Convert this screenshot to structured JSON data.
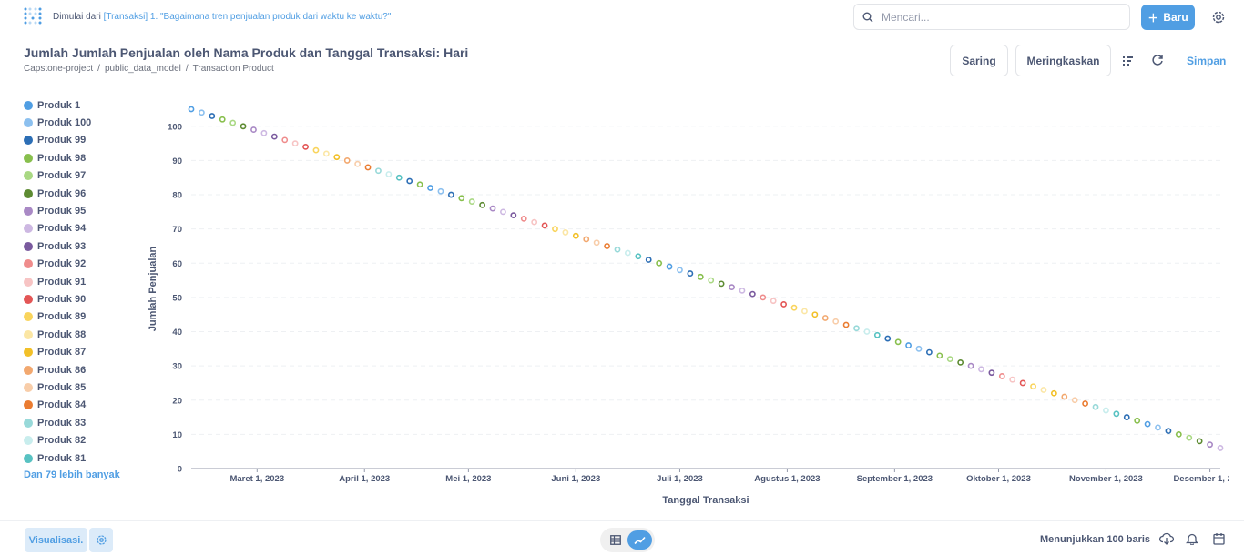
{
  "topbar": {
    "started_prefix": "Dimulai dari",
    "started_link": "[Transaksi] 1. \"Bagaimana tren penjualan produk dari waktu ke waktu?\"",
    "search_placeholder": "Mencari...",
    "new_label": "Baru"
  },
  "header": {
    "title": "Jumlah Jumlah Penjualan oleh Nama Produk dan Tanggal Transaksi: Hari",
    "breadcrumbs": [
      "Capstone-project",
      "public_data_model",
      "Transaction Product"
    ],
    "filter_label": "Saring",
    "summarize_label": "Meringkaskan",
    "save_label": "Simpan"
  },
  "legend": {
    "items": [
      {
        "label": "Produk 1",
        "color": "#509ee3"
      },
      {
        "label": "Produk 100",
        "color": "#8cc0ef"
      },
      {
        "label": "Produk 99",
        "color": "#2c6eb5"
      },
      {
        "label": "Produk 98",
        "color": "#88bf4d"
      },
      {
        "label": "Produk 97",
        "color": "#a9d883"
      },
      {
        "label": "Produk 96",
        "color": "#5d8b32"
      },
      {
        "label": "Produk 95",
        "color": "#a989c5"
      },
      {
        "label": "Produk 94",
        "color": "#cdb8e2"
      },
      {
        "label": "Produk 93",
        "color": "#7a5a9e"
      },
      {
        "label": "Produk 92",
        "color": "#ef8c8c"
      },
      {
        "label": "Produk 91",
        "color": "#f7c4c4"
      },
      {
        "label": "Produk 90",
        "color": "#e35656"
      },
      {
        "label": "Produk 89",
        "color": "#f9d45c"
      },
      {
        "label": "Produk 88",
        "color": "#fbe6a4"
      },
      {
        "label": "Produk 87",
        "color": "#f2c028"
      },
      {
        "label": "Produk 86",
        "color": "#f2a86f"
      },
      {
        "label": "Produk 85",
        "color": "#f8cda9"
      },
      {
        "label": "Produk 84",
        "color": "#ea7c31"
      },
      {
        "label": "Produk 83",
        "color": "#98d9d9"
      },
      {
        "label": "Produk 82",
        "color": "#c8eded"
      },
      {
        "label": "Produk 81",
        "color": "#58c2c2"
      }
    ],
    "more_label": "Dan 79 lebih banyak"
  },
  "chart_data": {
    "type": "scatter",
    "xlabel": "Tanggal Transaksi",
    "ylabel": "Jumlah Penjualan",
    "ylim": [
      0,
      100
    ],
    "yticks": [
      0,
      10,
      20,
      30,
      40,
      50,
      60,
      70,
      80,
      90,
      100
    ],
    "xticks": [
      "Maret 1, 2023",
      "April 1, 2023",
      "Mei 1, 2023",
      "Juni 1, 2023",
      "Juli 1, 2023",
      "Agustus 1, 2023",
      "September 1, 2023",
      "Oktober 1, 2023",
      "November 1, 2023",
      "Desember 1, 2023"
    ],
    "x_start": "2023-02-10",
    "x_end": "2023-12-04",
    "grid": true,
    "series_note": "100 series (Produk 1..100), one point each",
    "points": {
      "first": {
        "series": "Produk 1",
        "x": "2023-02-10",
        "y": 105
      },
      "last": {
        "series": "Produk 100",
        "x": "2023-12-04",
        "y": 6
      },
      "count": 100,
      "trend": "linear decreasing"
    },
    "palette": [
      "#509ee3",
      "#8cc0ef",
      "#2c6eb5",
      "#88bf4d",
      "#a9d883",
      "#5d8b32",
      "#a989c5",
      "#cdb8e2",
      "#7a5a9e",
      "#ef8c8c",
      "#f7c4c4",
      "#e35656",
      "#f9d45c",
      "#fbe6a4",
      "#f2c028",
      "#f2a86f",
      "#f8cda9",
      "#ea7c31",
      "#98d9d9",
      "#c8eded",
      "#58c2c2",
      "#2c6eb5",
      "#88bf4d"
    ]
  },
  "footer": {
    "viz_label": "Visualisasi.",
    "rows_label": "Menunjukkan 100 baris"
  }
}
